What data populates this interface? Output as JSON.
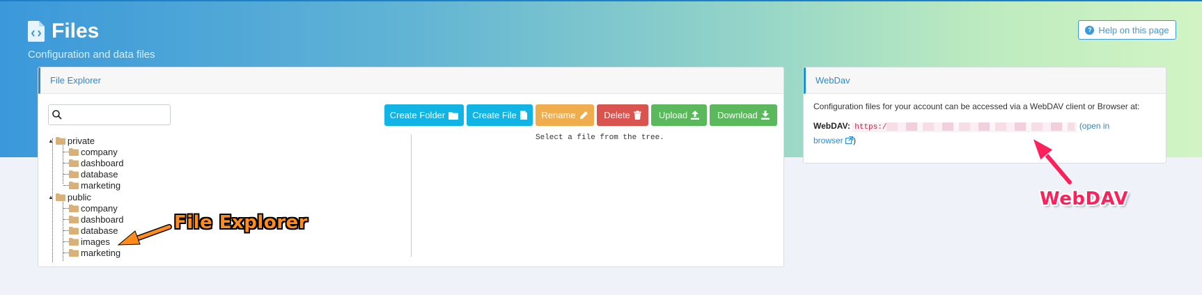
{
  "header": {
    "title": "Files",
    "subtitle": "Configuration and data files",
    "help_label": "Help on this page"
  },
  "file_explorer": {
    "panel_title": "File Explorer",
    "search": {
      "value": "",
      "placeholder": ""
    },
    "toolbar": {
      "create_folder": "Create Folder",
      "create_file": "Create File",
      "rename": "Rename",
      "delete": "Delete",
      "upload": "Upload",
      "download": "Download"
    },
    "tree": [
      {
        "label": "private",
        "children": [
          "company",
          "dashboard",
          "database",
          "marketing"
        ]
      },
      {
        "label": "public",
        "children": [
          "company",
          "dashboard",
          "database",
          "images",
          "marketing"
        ]
      }
    ],
    "empty_hint": "Select a file from the tree."
  },
  "webdav": {
    "panel_title": "WebDav",
    "description": "Configuration files for your account can be accessed via a WebDAV client or Browser at:",
    "label": "WebDAV:",
    "url_prefix": "https:/",
    "open_link_part1": "(open in",
    "open_link_part2": "browser",
    "close_paren": ")"
  },
  "annotations": {
    "file_explorer": "File Explorer",
    "webdav": "WebDAV"
  },
  "colors": {
    "accent": "#2a8ad2",
    "info_button": "#12b4e6",
    "warning_button": "#f0ad4e",
    "danger_button": "#d9534f",
    "success_button": "#5cb85c",
    "annotation_orange": "#ff8c1a",
    "annotation_pink": "#ff1f5a"
  },
  "icons": {
    "title": "code-file-icon",
    "help": "question-circle-icon",
    "search": "search-icon",
    "create_folder": "folder-icon",
    "create_file": "file-icon",
    "rename": "pencil-icon",
    "delete": "trash-icon",
    "upload": "upload-icon",
    "download": "download-icon",
    "tree_node": "folder-icon",
    "external_link": "external-link-icon"
  }
}
